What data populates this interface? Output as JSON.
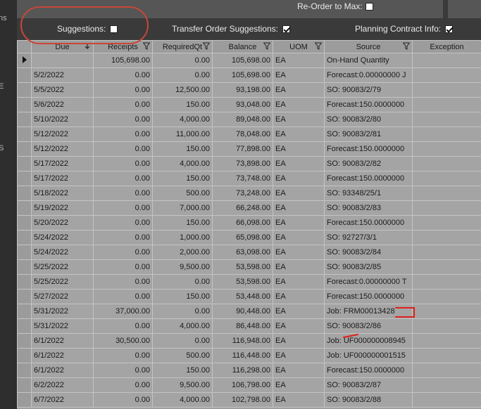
{
  "top": {
    "reorder_label": "Re-Order to Max:"
  },
  "options": {
    "suggestions_label": "Suggestions:",
    "suggestions_checked": false,
    "transfer_label": "Transfer Order Suggestions:",
    "transfer_checked": true,
    "planning_label": "Planning Contract Info:",
    "planning_checked": true
  },
  "left_fragments": [
    "ns",
    "E",
    "S"
  ],
  "columns": [
    "Due",
    "Receipts",
    "RequiredQt",
    "Balance",
    "UOM",
    "Source",
    "Exception"
  ],
  "rows": [
    {
      "due": "",
      "receipts": "105,698.00",
      "required": "0.00",
      "balance": "105,698.00",
      "uom": "EA",
      "source": "On-Hand Quantity",
      "exception": ""
    },
    {
      "due": "5/2/2022",
      "receipts": "0.00",
      "required": "0.00",
      "balance": "105,698.00",
      "uom": "EA",
      "source": "Forecast:0.00000000 J",
      "exception": ""
    },
    {
      "due": "5/5/2022",
      "receipts": "0.00",
      "required": "12,500.00",
      "balance": "93,198.00",
      "uom": "EA",
      "source": "SO: 90083/2/79",
      "exception": ""
    },
    {
      "due": "5/6/2022",
      "receipts": "0.00",
      "required": "150.00",
      "balance": "93,048.00",
      "uom": "EA",
      "source": "Forecast:150.0000000",
      "exception": ""
    },
    {
      "due": "5/10/2022",
      "receipts": "0.00",
      "required": "4,000.00",
      "balance": "89,048.00",
      "uom": "EA",
      "source": "SO: 90083/2/80",
      "exception": ""
    },
    {
      "due": "5/12/2022",
      "receipts": "0.00",
      "required": "11,000.00",
      "balance": "78,048.00",
      "uom": "EA",
      "source": "SO: 90083/2/81",
      "exception": ""
    },
    {
      "due": "5/12/2022",
      "receipts": "0.00",
      "required": "150.00",
      "balance": "77,898.00",
      "uom": "EA",
      "source": "Forecast:150.0000000",
      "exception": ""
    },
    {
      "due": "5/17/2022",
      "receipts": "0.00",
      "required": "4,000.00",
      "balance": "73,898.00",
      "uom": "EA",
      "source": "SO: 90083/2/82",
      "exception": ""
    },
    {
      "due": "5/17/2022",
      "receipts": "0.00",
      "required": "150.00",
      "balance": "73,748.00",
      "uom": "EA",
      "source": "Forecast:150.0000000",
      "exception": ""
    },
    {
      "due": "5/18/2022",
      "receipts": "0.00",
      "required": "500.00",
      "balance": "73,248.00",
      "uom": "EA",
      "source": "SO: 93348/25/1",
      "exception": ""
    },
    {
      "due": "5/19/2022",
      "receipts": "0.00",
      "required": "7,000.00",
      "balance": "66,248.00",
      "uom": "EA",
      "source": "SO: 90083/2/83",
      "exception": ""
    },
    {
      "due": "5/20/2022",
      "receipts": "0.00",
      "required": "150.00",
      "balance": "66,098.00",
      "uom": "EA",
      "source": "Forecast:150.0000000",
      "exception": ""
    },
    {
      "due": "5/24/2022",
      "receipts": "0.00",
      "required": "1,000.00",
      "balance": "65,098.00",
      "uom": "EA",
      "source": "SO: 92727/3/1",
      "exception": ""
    },
    {
      "due": "5/24/2022",
      "receipts": "0.00",
      "required": "2,000.00",
      "balance": "63,098.00",
      "uom": "EA",
      "source": "SO: 90083/2/84",
      "exception": ""
    },
    {
      "due": "5/25/2022",
      "receipts": "0.00",
      "required": "9,500.00",
      "balance": "53,598.00",
      "uom": "EA",
      "source": "SO: 90083/2/85",
      "exception": ""
    },
    {
      "due": "5/25/2022",
      "receipts": "0.00",
      "required": "0.00",
      "balance": "53,598.00",
      "uom": "EA",
      "source": "Forecast:0.00000000 T",
      "exception": ""
    },
    {
      "due": "5/27/2022",
      "receipts": "0.00",
      "required": "150.00",
      "balance": "53,448.00",
      "uom": "EA",
      "source": "Forecast:150.0000000",
      "exception": ""
    },
    {
      "due": "5/31/2022",
      "receipts": "37,000.00",
      "required": "0.00",
      "balance": "90,448.00",
      "uom": "EA",
      "source": "Job: FRM00013428",
      "exception": ""
    },
    {
      "due": "5/31/2022",
      "receipts": "0.00",
      "required": "4,000.00",
      "balance": "86,448.00",
      "uom": "EA",
      "source": "SO: 90083/2/86",
      "exception": ""
    },
    {
      "due": "6/1/2022",
      "receipts": "30,500.00",
      "required": "0.00",
      "balance": "116,948.00",
      "uom": "EA",
      "source": "Job: UF000000008945",
      "exception": ""
    },
    {
      "due": "6/1/2022",
      "receipts": "0.00",
      "required": "500.00",
      "balance": "116,448.00",
      "uom": "EA",
      "source": "Job: UF000000001515",
      "exception": ""
    },
    {
      "due": "6/1/2022",
      "receipts": "0.00",
      "required": "150.00",
      "balance": "116,298.00",
      "uom": "EA",
      "source": "Forecast:150.0000000",
      "exception": ""
    },
    {
      "due": "6/2/2022",
      "receipts": "0.00",
      "required": "9,500.00",
      "balance": "106,798.00",
      "uom": "EA",
      "source": "SO: 90083/2/87",
      "exception": ""
    },
    {
      "due": "6/7/2022",
      "receipts": "0.00",
      "required": "4,000.00",
      "balance": "102,798.00",
      "uom": "EA",
      "source": "SO: 90083/2/88",
      "exception": ""
    }
  ],
  "colors": {
    "annotation_red": "#c8463a",
    "markup_red": "#e0201a"
  }
}
